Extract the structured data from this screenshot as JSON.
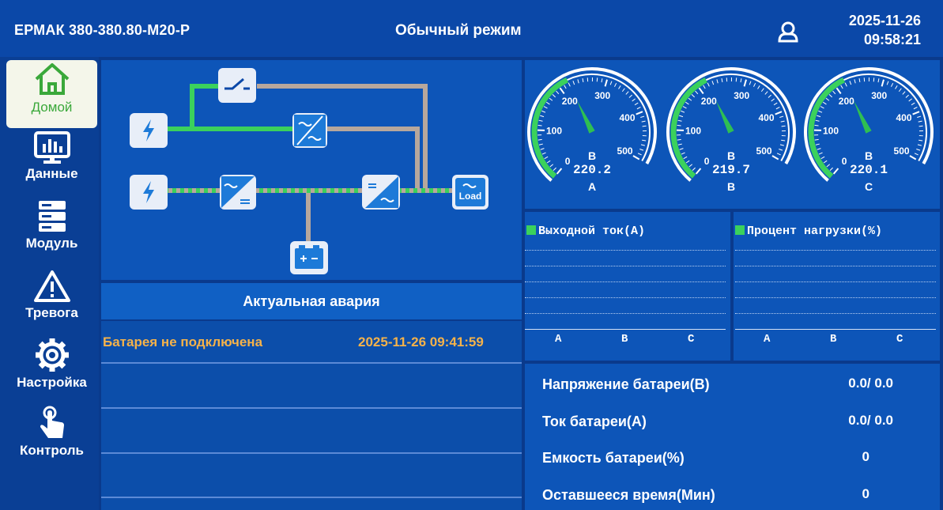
{
  "header": {
    "model": "ЕРМАК 380-380.80-М20-Р",
    "mode": "Обычный режим",
    "date": "2025-11-26",
    "time": "09:58:21"
  },
  "sidebar": {
    "items": [
      {
        "label": "Домой",
        "icon": "home-icon"
      },
      {
        "label": "Данные",
        "icon": "monitor-chart-icon"
      },
      {
        "label": "Модуль",
        "icon": "module-rack-icon"
      },
      {
        "label": "Тревога",
        "icon": "warning-icon"
      },
      {
        "label": "Настройка",
        "icon": "gear-icon"
      },
      {
        "label": "Контроль",
        "icon": "touch-hand-icon"
      }
    ]
  },
  "diagram": {
    "load_label": "Load"
  },
  "alarm": {
    "title": "Актуальная авария",
    "items": [
      {
        "text": "Батарея не подключена",
        "time": "2025-11-26 09:41:59"
      }
    ]
  },
  "gauges": [
    {
      "phase": "A",
      "center_label": "B",
      "value": "220.2",
      "ticks": [
        "0",
        "100",
        "200",
        "300",
        "400",
        "500"
      ],
      "value_num": 220.2
    },
    {
      "phase": "B",
      "center_label": "B",
      "value": "219.7",
      "ticks": [
        "0",
        "100",
        "200",
        "300",
        "400",
        "500"
      ],
      "value_num": 219.7
    },
    {
      "phase": "C",
      "center_label": "B",
      "value": "220.1",
      "ticks": [
        "0",
        "100",
        "200",
        "300",
        "400",
        "500"
      ],
      "value_num": 220.1
    }
  ],
  "bars": {
    "output_current_title": "Выходной ток(А)",
    "load_percent_title": "Процент нагрузки(%)",
    "phases": [
      "A",
      "B",
      "C"
    ]
  },
  "battery": {
    "rows": [
      {
        "label": "Напряжение батареи(В)",
        "value": "0.0/ 0.0"
      },
      {
        "label": "Ток батареи(А)",
        "value": "0.0/ 0.0"
      },
      {
        "label": "Емкость батареи(%)",
        "value": "0"
      },
      {
        "label": "Оставшееся время(Мин)",
        "value": "0"
      }
    ]
  },
  "colors": {
    "background": "#0a3a8c",
    "accent_green": "#3bd15c",
    "alarm_orange": "#f5b24a",
    "panel_blue": "#0d55b8"
  }
}
